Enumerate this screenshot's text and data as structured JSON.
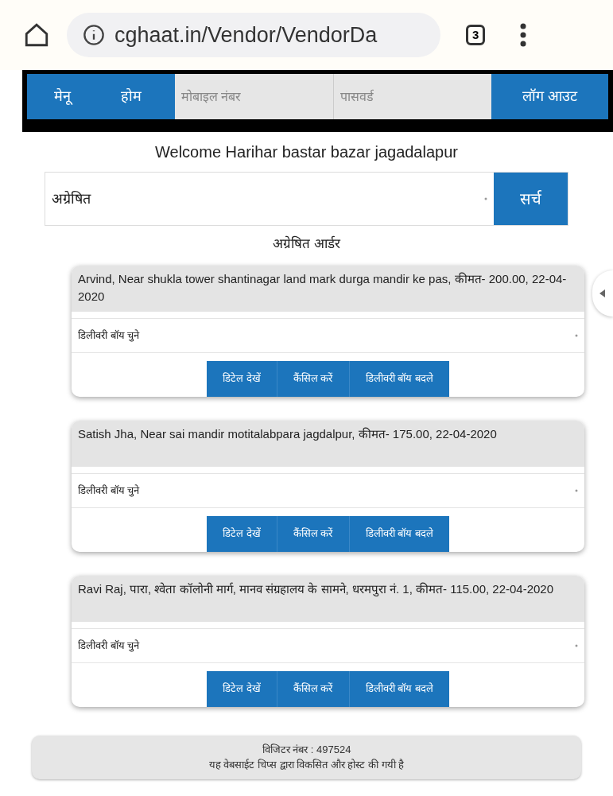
{
  "browser": {
    "url": "cghaat.in/Vendor/VendorDa",
    "tab_count": "3"
  },
  "nav": {
    "menu": "मेनू",
    "home": "होम",
    "mobile_placeholder": "मोबाइल नंबर",
    "password_placeholder": "पासवर्ड",
    "logout": "लॉग आउट"
  },
  "welcome": "Welcome Harihar bastar bazar jagadalapur",
  "filter": {
    "value": "अग्रेषित",
    "search": "सर्च"
  },
  "heading": "अग्रेषित आर्डर",
  "orders": [
    {
      "details": "Arvind, Near shukla tower shantinagar land mark durga mandir ke pas, कीमत- 200.00, 22-04-2020",
      "delivery_placeholder": "डिलीवरी बॉय चुने",
      "actions": [
        "डिटेल देखें",
        "कैंसिल करें",
        "डिलीवरी बॉय बदले"
      ]
    },
    {
      "details": "Satish Jha, Near sai mandir motitalabpara jagdalpur, कीमत- 175.00, 22-04-2020",
      "delivery_placeholder": "डिलीवरी बॉय चुने",
      "actions": [
        "डिटेल देखें",
        "कैंसिल करें",
        "डिलीवरी बॉय बदले"
      ]
    },
    {
      "details": "Ravi Raj, पारा, श्वेता कॉलोनी मार्ग, मानव संग्रहालय के सामने, धरमपुरा नं. 1, कीमत- 115.00, 22-04-2020",
      "delivery_placeholder": "डिलीवरी बॉय चुने",
      "actions": [
        "डिटेल देखें",
        "कैंसिल करें",
        "डिलीवरी बॉय बदले"
      ]
    }
  ],
  "footer": {
    "visitors": "विजिटर नंबर : 497524",
    "credit": "यह वेबसाईट चिप्स द्वारा विकसित और होस्ट की गयी है"
  }
}
